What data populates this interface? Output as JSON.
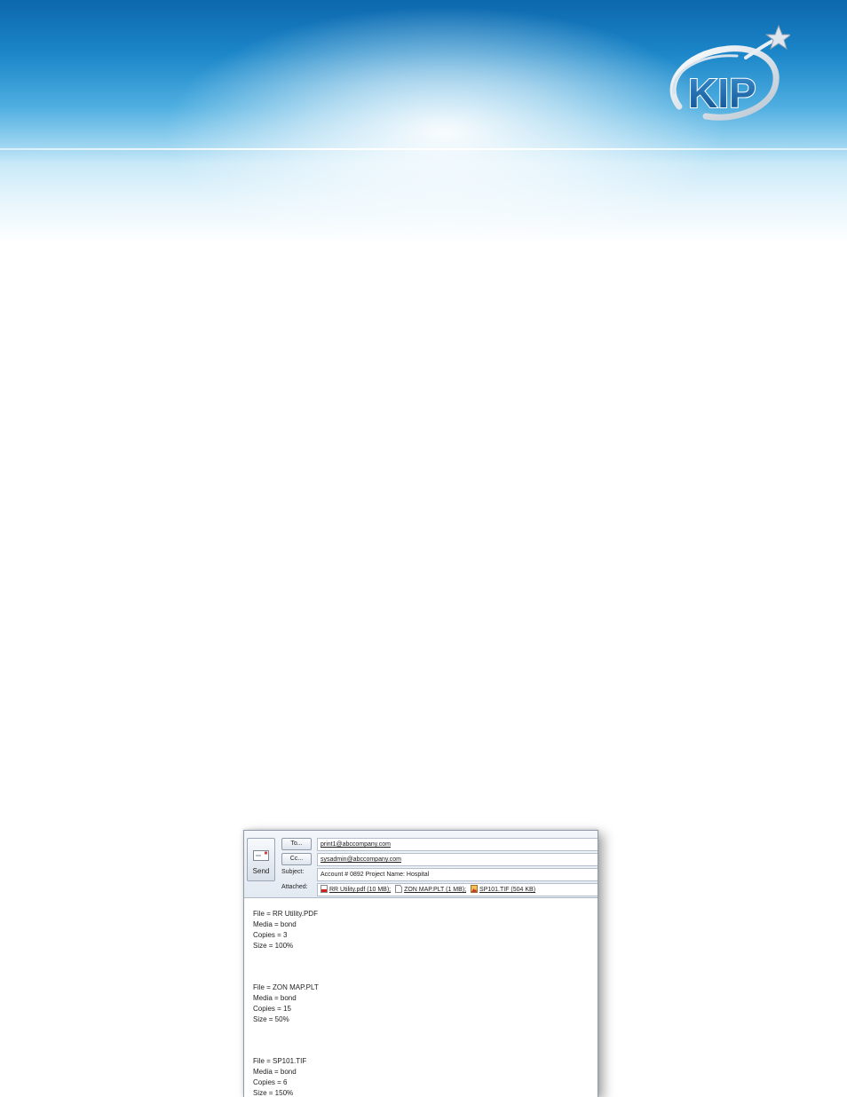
{
  "email": {
    "send_label": "Send",
    "to_label": "To...",
    "to_value": "print1@abccompany.com",
    "cc_label": "Cc...",
    "cc_value": "sysadmin@abccompany.com",
    "subject_label": "Subject:",
    "subject_value": "Account # 0892   Project Name: Hospital",
    "attached_label": "Attached:",
    "attachments": [
      {
        "name": "RR Utility.pdf (10 MB);",
        "icon": "pdf-file-icon"
      },
      {
        "name": "ZON MAP.PLT (1 MB);",
        "icon": "generic-file-icon"
      },
      {
        "name": "SP101.TIF (504 KB)",
        "icon": "image-file-icon"
      }
    ],
    "body": [
      {
        "file": "File = RR Utility.PDF",
        "media": "Media = bond",
        "copies": "Copies = 3",
        "size": "Size = 100%"
      },
      {
        "file": "File = ZON MAP.PLT",
        "media": "Media = bond",
        "copies": "Copies = 15",
        "size": "Size = 50%"
      },
      {
        "file": "File = SP101.TIF",
        "media": "Media = bond",
        "copies": "Copies = 6",
        "size": "Size = 150%"
      }
    ]
  },
  "logo": {
    "text": "KIP",
    "icon": "kip-logo"
  },
  "colors": {
    "banner_dark": "#0d67ad",
    "logo_blue": "#1d6fb0"
  }
}
